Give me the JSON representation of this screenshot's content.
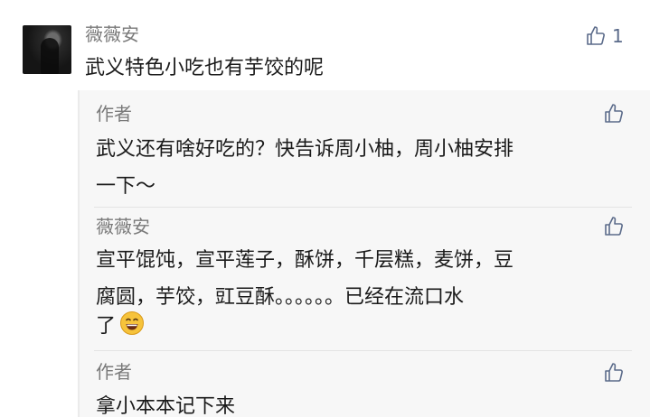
{
  "comment": {
    "author": "薇薇安",
    "text": "武义特色小吃也有芋饺的呢",
    "like_count": "1"
  },
  "replies": [
    {
      "author": "作者",
      "lines": [
        "武义还有啥好吃的？快告诉周小柚，周小柚安排",
        "一下～"
      ]
    },
    {
      "author": "薇薇安",
      "lines": [
        "宣平馄饨，宣平莲子，酥饼，千层糕，麦饼，豆",
        "腐圆，芋饺，豇豆酥。。。。。。已经在流口水",
        "了"
      ],
      "emoji": "grinning-face"
    },
    {
      "author": "作者",
      "lines": [
        "拿小本本记下来"
      ]
    }
  ],
  "icons": {
    "like": "thumbs-up-icon"
  },
  "colors": {
    "name": "#7a7a7a",
    "text": "#1a1a1a",
    "like": "#5b6b8a",
    "reply_bg": "#f7f7f7"
  }
}
